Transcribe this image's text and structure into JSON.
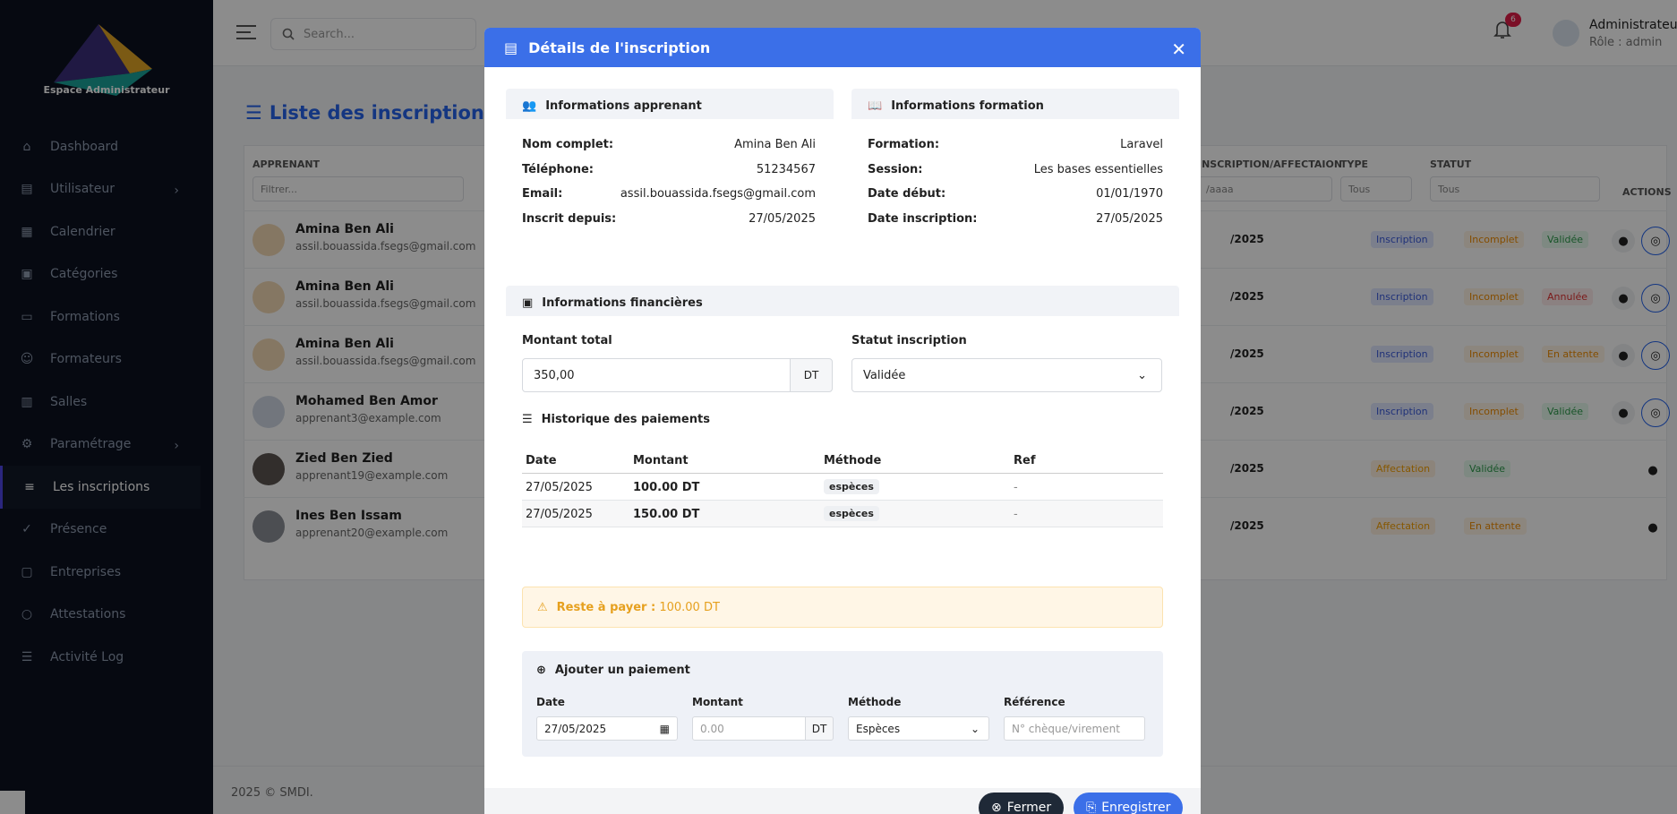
{
  "sidebar": {
    "logo_text": "Espace Administrateur",
    "items": [
      {
        "label": "Dashboard",
        "icon": "home-icon"
      },
      {
        "label": "Utilisateur",
        "icon": "file-icon",
        "chevron": true
      },
      {
        "label": "Calendrier",
        "icon": "calendar-icon"
      },
      {
        "label": "Catégories",
        "icon": "grid-icon"
      },
      {
        "label": "Formations",
        "icon": "book-icon"
      },
      {
        "label": "Formateurs",
        "icon": "user-icon"
      },
      {
        "label": "Salles",
        "icon": "building-icon"
      },
      {
        "label": "Paramétrage",
        "icon": "gear-icon",
        "chevron": true
      },
      {
        "label": "Les inscriptions",
        "icon": "list-edit-icon",
        "active": true
      },
      {
        "label": "Présence",
        "icon": "user-check-icon"
      },
      {
        "label": "Entreprises",
        "icon": "briefcase-icon"
      },
      {
        "label": "Attestations",
        "icon": "circle-icon"
      },
      {
        "label": "Activité Log",
        "icon": "list-icon"
      }
    ]
  },
  "topbar": {
    "search_placeholder": "Search...",
    "notifications_count": "6",
    "user_name": "Administrateur",
    "user_role": "Rôle : admin"
  },
  "page": {
    "title": "Liste des inscriptions et a",
    "columns": {
      "apprenant": "APPRENANT",
      "inscription_affectation": "INSCRIPTION/AFFECTAION",
      "type": "TYPE",
      "statut": "STATUT",
      "actions": "ACTIONS"
    },
    "filters": {
      "apprenant_placeholder": "Filtrer...",
      "date_value": "/aaaa",
      "type_value": "Tous",
      "statut_value": "Tous"
    },
    "rows": [
      {
        "name": "Amina Ben Ali",
        "email": "assil.bouassida.fsegs@gmail.com",
        "date": "/2025",
        "type": "Inscription",
        "incomplet": "Incomplet",
        "status": "Validée"
      },
      {
        "name": "Amina Ben Ali",
        "email": "assil.bouassida.fsegs@gmail.com",
        "date": "/2025",
        "type": "Inscription",
        "incomplet": "Incomplet",
        "status": "Annulée"
      },
      {
        "name": "Amina Ben Ali",
        "email": "assil.bouassida.fsegs@gmail.com",
        "date": "/2025",
        "type": "Inscription",
        "incomplet": "Incomplet",
        "status": "En attente"
      },
      {
        "name": "Mohamed Ben Amor",
        "email": "apprenant3@example.com",
        "date": "/2025",
        "type": "Inscription",
        "incomplet": "Incomplet",
        "status": "Validée"
      },
      {
        "name": "Zied Ben Zied",
        "email": "apprenant19@example.com",
        "date": "/2025",
        "type": "Affectation",
        "incomplet": "",
        "status": "Validée"
      },
      {
        "name": "Ines Ben Issam",
        "email": "apprenant20@example.com",
        "date": "/2025",
        "type": "Affectation",
        "incomplet": "",
        "status": "En attente"
      }
    ],
    "footer": "2025 © SMDI."
  },
  "modal": {
    "title": "Détails de l'inscription",
    "apprenant": {
      "title": "Informations apprenant",
      "fields": [
        {
          "label": "Nom complet:",
          "value": "Amina Ben Ali"
        },
        {
          "label": "Téléphone:",
          "value": "51234567"
        },
        {
          "label": "Email:",
          "value": "assil.bouassida.fsegs@gmail.com"
        },
        {
          "label": "Inscrit depuis:",
          "value": "27/05/2025"
        }
      ]
    },
    "formation": {
      "title": "Informations formation",
      "fields": [
        {
          "label": "Formation:",
          "value": "Laravel"
        },
        {
          "label": "Session:",
          "value": "Les bases essentielles"
        },
        {
          "label": "Date début:",
          "value": "01/01/1970"
        },
        {
          "label": "Date inscription:",
          "value": "27/05/2025"
        }
      ]
    },
    "financier": {
      "title": "Informations financières",
      "montant_label": "Montant total",
      "montant_value": "350,00",
      "currency": "DT",
      "statut_label": "Statut inscription",
      "statut_value": "Validée"
    },
    "historique": {
      "title": "Historique des paiements",
      "headers": [
        "Date",
        "Montant",
        "Méthode",
        "Ref"
      ],
      "rows": [
        {
          "date": "27/05/2025",
          "montant": "100.00 DT",
          "methode": "espèces",
          "ref": "-"
        },
        {
          "date": "27/05/2025",
          "montant": "150.00 DT",
          "methode": "espèces",
          "ref": "-"
        }
      ]
    },
    "reste": {
      "label": "Reste à payer :",
      "value": "100.00 DT"
    },
    "ajout": {
      "title": "Ajouter un paiement",
      "date_label": "Date",
      "date_value": "27/05/2025",
      "montant_label": "Montant",
      "montant_placeholder": "0.00",
      "currency": "DT",
      "methode_label": "Méthode",
      "methode_value": "Espèces",
      "reference_label": "Référence",
      "reference_placeholder": "N° chèque/virement"
    },
    "buttons": {
      "close": "Fermer",
      "save": "Enregistrer"
    }
  }
}
